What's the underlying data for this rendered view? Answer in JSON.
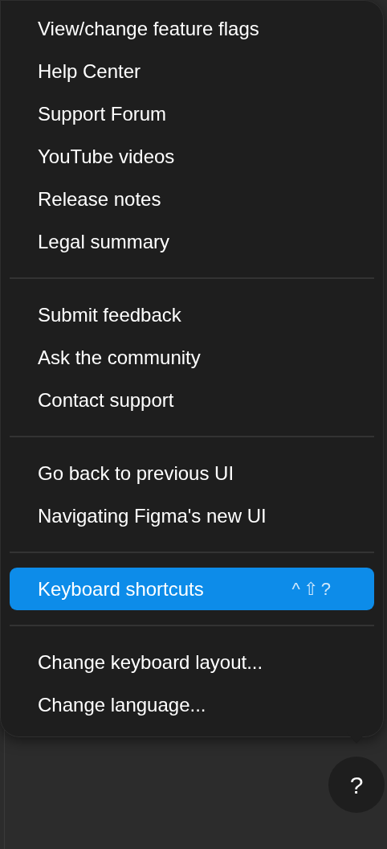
{
  "menu": {
    "groups": [
      {
        "items": [
          {
            "label": "View/change feature flags",
            "selected": false
          },
          {
            "label": "Help Center",
            "selected": false
          },
          {
            "label": "Support Forum",
            "selected": false
          },
          {
            "label": "YouTube videos",
            "selected": false
          },
          {
            "label": "Release notes",
            "selected": false
          },
          {
            "label": "Legal summary",
            "selected": false
          }
        ]
      },
      {
        "items": [
          {
            "label": "Submit feedback",
            "selected": false
          },
          {
            "label": "Ask the community",
            "selected": false
          },
          {
            "label": "Contact support",
            "selected": false
          }
        ]
      },
      {
        "items": [
          {
            "label": "Go back to previous UI",
            "selected": false
          },
          {
            "label": "Navigating Figma's new UI",
            "selected": false
          }
        ]
      },
      {
        "items": [
          {
            "label": "Keyboard shortcuts",
            "selected": true,
            "shortcut": "^⇧?"
          }
        ]
      },
      {
        "items": [
          {
            "label": "Change keyboard layout...",
            "selected": false
          },
          {
            "label": "Change language...",
            "selected": false
          }
        ]
      }
    ]
  },
  "help_button": {
    "label": "?"
  }
}
